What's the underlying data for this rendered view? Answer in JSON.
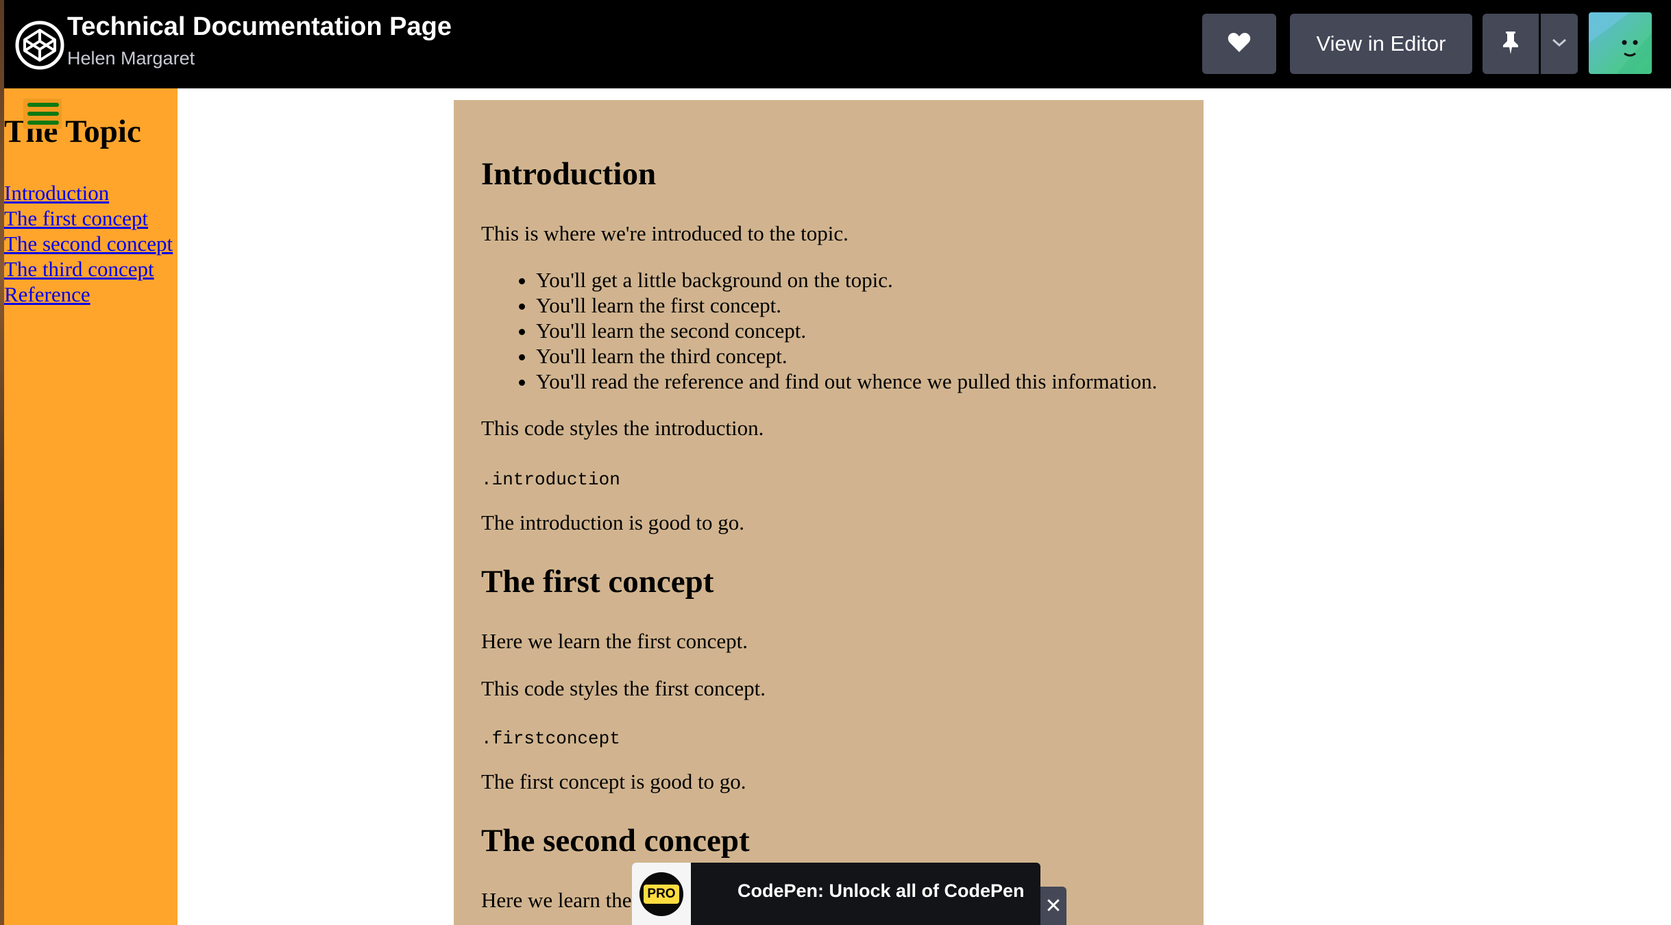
{
  "header": {
    "title": "Technical Documentation Page",
    "author": "Helen Margaret",
    "like_icon": "heart-icon",
    "editor_label": "View in Editor",
    "pin_icon": "pin-icon",
    "dropdown_icon": "chevron-down-icon"
  },
  "sidebar": {
    "title": "The Topic",
    "menu_icon": "hamburger-icon",
    "links": [
      {
        "label": "Introduction"
      },
      {
        "label": "The first concept"
      },
      {
        "label": "The second concept"
      },
      {
        "label": "The third concept"
      },
      {
        "label": "Reference"
      }
    ]
  },
  "main": {
    "introduction": {
      "heading": "Introduction",
      "text": "This is where we're introduced to the topic.",
      "bullets": [
        "You'll get a little background on the topic.",
        "You'll learn the first concept.",
        "You'll learn the second concept.",
        "You'll learn the third concept.",
        "You'll read the reference and find out whence we pulled this information."
      ],
      "styles_text": "This code styles the introduction.",
      "code": ".introduction",
      "done_text": "The introduction is good to go."
    },
    "first_concept": {
      "heading": "The first concept",
      "text": "Here we learn the first concept.",
      "styles_text": "This code styles the first concept.",
      "code": ".firstconcept",
      "done_text": "The first concept is good to go."
    },
    "second_concept": {
      "heading": "The second concept",
      "text": "Here we learn the second concept."
    }
  },
  "promo": {
    "badge": "PRO",
    "text": "CodePen: Unlock all of CodePen",
    "close_icon": "close-icon"
  },
  "colors": {
    "header_bg": "#000000",
    "sidebar_bg": "#ffa52c",
    "content_bg": "#d1b48f",
    "link": "#0000ee",
    "button_bg": "#444857"
  }
}
